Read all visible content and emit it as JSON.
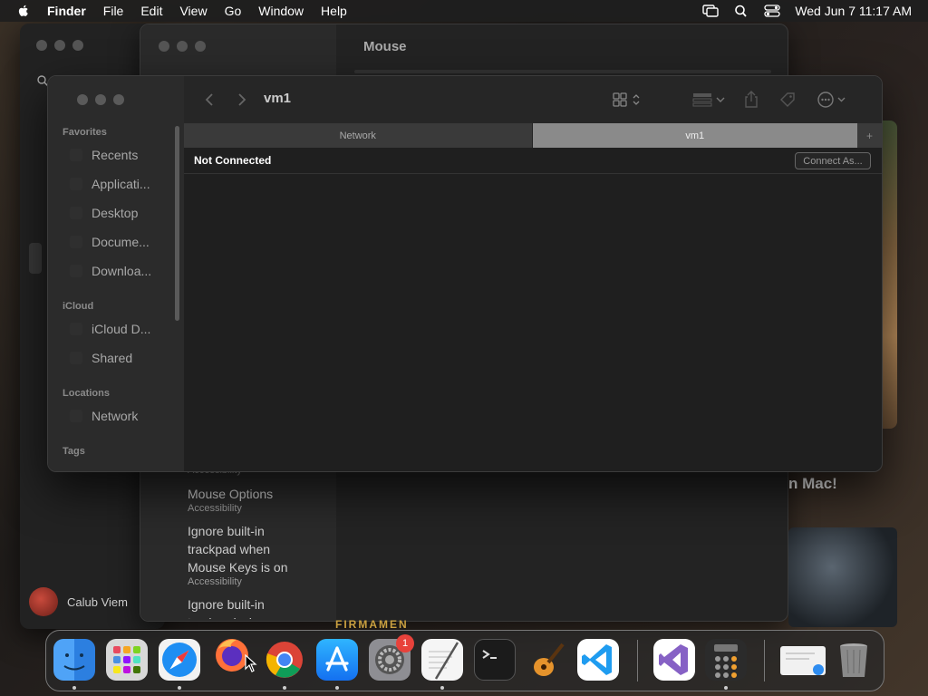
{
  "menubar": {
    "app_name": "Finder",
    "items": [
      "File",
      "Edit",
      "View",
      "Go",
      "Window",
      "Help"
    ],
    "datetime": "Wed Jun 7  11:17 AM"
  },
  "settings_window": {
    "title": "Mouse",
    "results": [
      {
        "title": "",
        "subtitle": "Accessibility"
      },
      {
        "title": "Mouse Options",
        "subtitle": "Accessibility"
      },
      {
        "title": "Ignore built-in trackpad when Mouse Keys is on",
        "subtitle": "Accessibility"
      },
      {
        "title": "Ignore built-in trackpad when",
        "subtitle": ""
      }
    ]
  },
  "background": {
    "user_name": "Calub Viem",
    "mac_text": "n Mac!",
    "firm_text": "FIRMAMEN"
  },
  "finder": {
    "title": "vm1",
    "sidebar": {
      "favorites_label": "Favorites",
      "favorites": [
        "Recents",
        "Applicati...",
        "Desktop",
        "Docume...",
        "Downloa..."
      ],
      "icloud_label": "iCloud",
      "icloud": [
        "iCloud D...",
        "Shared"
      ],
      "locations_label": "Locations",
      "locations": [
        "Network"
      ],
      "tags_label": "Tags"
    },
    "tabs": [
      {
        "label": "Network",
        "active": false
      },
      {
        "label": "vm1",
        "active": true
      }
    ],
    "tab_add": "+",
    "status_text": "Not Connected",
    "connect_button": "Connect As..."
  },
  "dock": {
    "icons": [
      "finder-icon",
      "launchpad-icon",
      "safari-icon",
      "firefox-icon",
      "chrome-icon",
      "app-store-icon",
      "system-settings-icon",
      "textedit-icon",
      "terminal-icon",
      "garageband-icon",
      "vscode-icon",
      "visual-studio-icon",
      "calculator-icon",
      "preview-icon",
      "trash-icon"
    ],
    "settings_badge": "1"
  },
  "colors": {
    "accent_badge": "#e8423b",
    "active_tab": "#8a8a8a"
  }
}
